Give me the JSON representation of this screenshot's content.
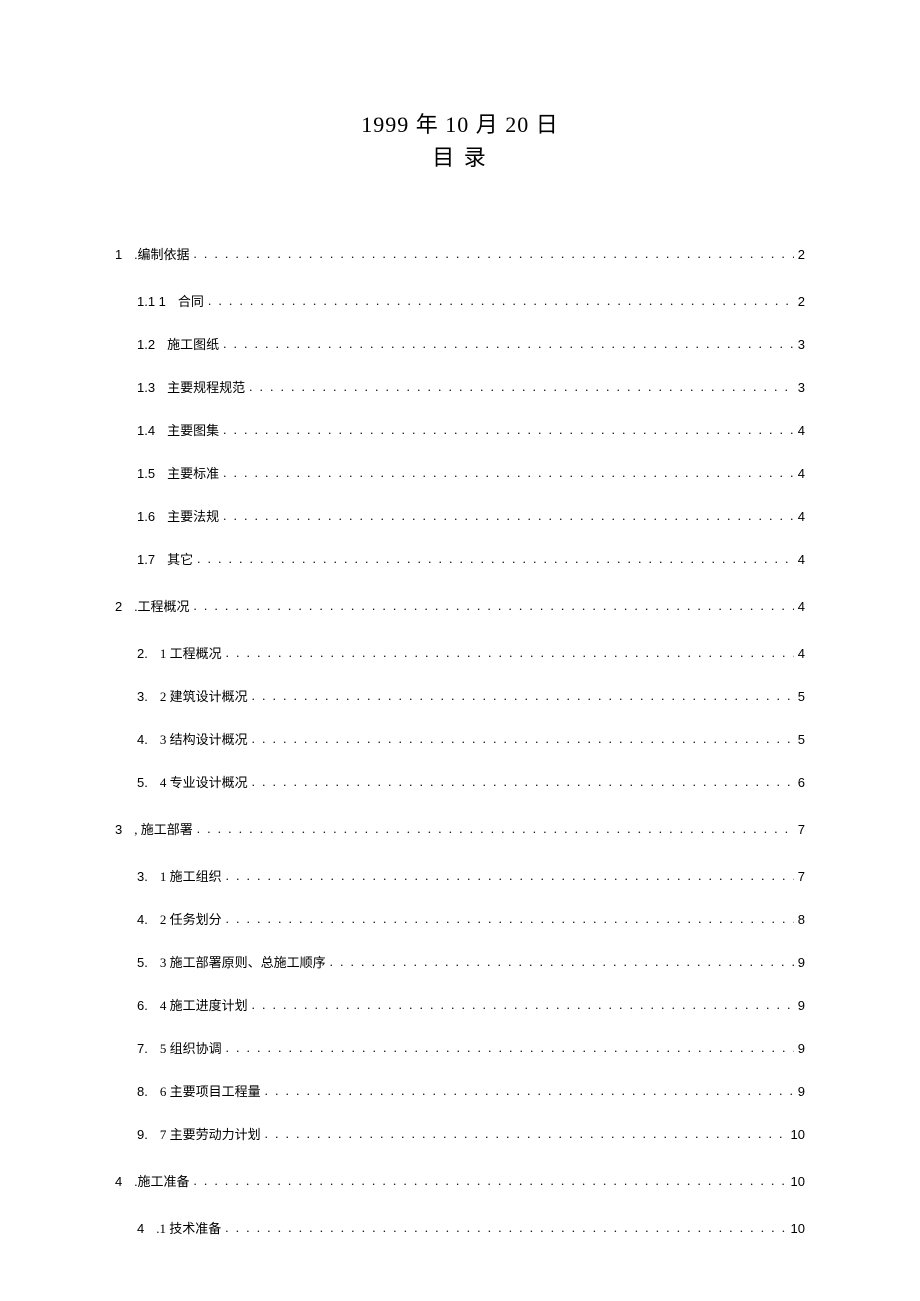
{
  "header": {
    "date": "1999 年 10 月 20 日",
    "toc_title": "目 录"
  },
  "sections": [
    {
      "num": "1",
      "label": ".编制依据",
      "page": "2",
      "items": [
        {
          "num": "1.1 1",
          "label": "合同",
          "page": "2"
        },
        {
          "num": "1.2",
          "label": "施工图纸",
          "page": "3"
        },
        {
          "num": "1.3",
          "label": "主要规程规范",
          "page": "3"
        },
        {
          "num": "1.4",
          "label": "主要图集",
          "page": "4"
        },
        {
          "num": "1.5",
          "label": "主要标准",
          "page": "4"
        },
        {
          "num": "1.6",
          "label": "主要法规",
          "page": "4"
        },
        {
          "num": "1.7",
          "label": "其它",
          "page": "4"
        }
      ]
    },
    {
      "num": "2",
      "label": ".工程概况",
      "page": "4",
      "items": [
        {
          "num": "2.",
          "label": "1 工程概况",
          "page": "4"
        },
        {
          "num": "3.",
          "label": "2 建筑设计概况",
          "page": "5"
        },
        {
          "num": "4.",
          "label": "3 结构设计概况",
          "page": "5"
        },
        {
          "num": "5.",
          "label": "4 专业设计概况",
          "page": "6"
        }
      ]
    },
    {
      "num": "3",
      "label": ", 施工部署",
      "page": "7",
      "items": [
        {
          "num": "3.",
          "label": "1 施工组织",
          "page": "7"
        },
        {
          "num": "4.",
          "label": "2 任务划分",
          "page": "8"
        },
        {
          "num": "5.",
          "label": "3 施工部署原则、总施工顺序",
          "page": "9"
        },
        {
          "num": "6.",
          "label": "4 施工进度计划",
          "page": "9"
        },
        {
          "num": "7.",
          "label": "5 组织协调",
          "page": "9"
        },
        {
          "num": "8.",
          "label": "6 主要项目工程量",
          "page": "9"
        },
        {
          "num": "9.",
          "label": "7 主要劳动力计划",
          "page": "10"
        }
      ]
    },
    {
      "num": "4",
      "label": ".施工准备",
      "page": "10",
      "items": [
        {
          "num": "4",
          "label": ".1 技术准备",
          "page": "10"
        }
      ]
    }
  ]
}
